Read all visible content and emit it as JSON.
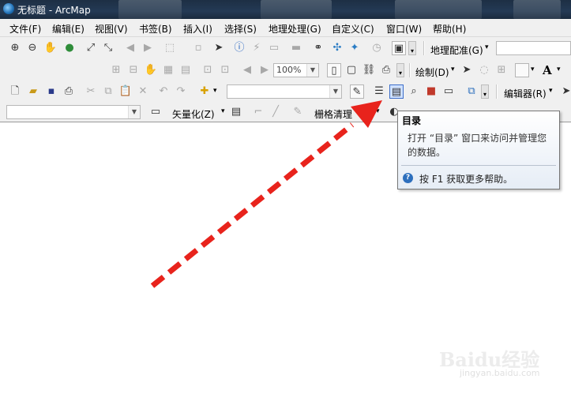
{
  "window": {
    "title": "无标题 - ArcMap"
  },
  "menu": {
    "items": [
      "文件(F)",
      "编辑(E)",
      "视图(V)",
      "书签(B)",
      "插入(I)",
      "选择(S)",
      "地理处理(G)",
      "自定义(C)",
      "窗口(W)",
      "帮助(H)"
    ]
  },
  "toolbars": {
    "georef_label": "地理配准(G)",
    "zoom_value": "100%",
    "draw_label": "绘制(D)",
    "text_tool_glyph": "A",
    "editor_label": "编辑器(R)",
    "vectorize_label": "矢量化(Z)",
    "raster_clean_label": "栅格清理"
  },
  "tooltip": {
    "title": "目录",
    "description": "打开 “目录” 窗口来访问并管理您的数据。",
    "help_key": "F1",
    "help_text": "按 F1 获取更多帮助。"
  },
  "annotation": {
    "arrow_color": "#e8231c"
  },
  "watermark": {
    "logo": "Baidu经验",
    "url": "jingyan.baidu.com"
  },
  "icons": {
    "zoom_in": "zoom-in-icon",
    "zoom_out": "zoom-out-icon",
    "pan": "pan-hand-icon",
    "globe": "full-extent-icon",
    "catalog": "catalog-window-icon",
    "help": "help-circle-icon"
  },
  "colors": {
    "titlebar": "#1d2f44",
    "toolbar_bg": "#f0f0f0",
    "highlight": "#cfe1ff"
  }
}
